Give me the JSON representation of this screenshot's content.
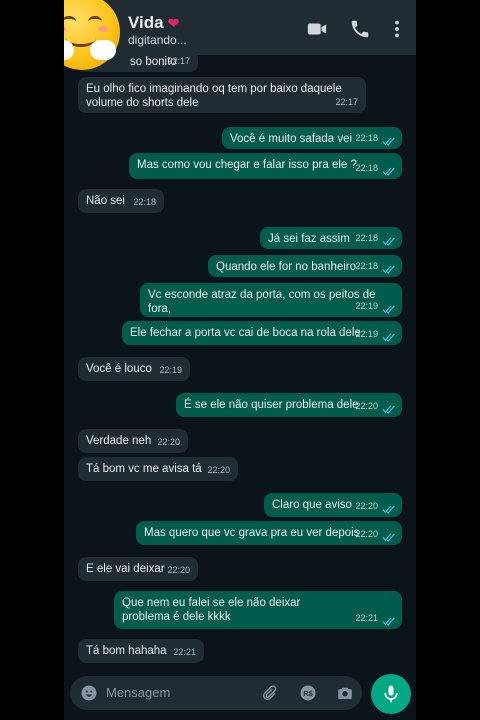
{
  "header": {
    "contact_name": "Vida",
    "heart_glyph": "❤",
    "status": "digitando...",
    "icons": [
      "video-call-icon",
      "phone-icon",
      "more-options-icon"
    ]
  },
  "messages": [
    {
      "dir": "in",
      "text": "so bonito",
      "time": "22:17"
    },
    {
      "dir": "in",
      "text": "Eu olho fico imaginando oq tem por baixo daquele volume do shorts dele",
      "time": "22:17"
    },
    {
      "dir": "out",
      "text": "Você é muito safada vei",
      "time": "22:18"
    },
    {
      "dir": "out",
      "text": "Mas como vou chegar e falar isso pra ele ?",
      "time": "22:18"
    },
    {
      "dir": "in",
      "text": "Não sei",
      "time": "22:18"
    },
    {
      "dir": "out",
      "text": "Já sei faz assim",
      "time": "22:18"
    },
    {
      "dir": "out",
      "text": "Quando ele for no banheiro",
      "time": "22:18"
    },
    {
      "dir": "out",
      "text": "Vc esconde atraz da porta, com os peitos de fora,",
      "time": "22:19"
    },
    {
      "dir": "out",
      "text": "Ele fechar a porta vc cai de boca na rola dele",
      "time": "22:19"
    },
    {
      "dir": "in",
      "text": "Você é louco",
      "time": "22:19"
    },
    {
      "dir": "out",
      "text": "É se ele não quiser problema dele",
      "time": "22:20"
    },
    {
      "dir": "in",
      "text": "Verdade neh",
      "time": "22:20"
    },
    {
      "dir": "in",
      "text": "Tá bom vc me avisa tá",
      "time": "22:20"
    },
    {
      "dir": "out",
      "text": "Claro que aviso",
      "time": "22:20"
    },
    {
      "dir": "out",
      "text": "Mas quero que vc grava pra eu ver depois",
      "time": "22:20"
    },
    {
      "dir": "in",
      "text": "E ele vai deixar",
      "time": "22:20"
    },
    {
      "dir": "out",
      "text": "Que nem eu falei se ele não deixar problema é dele kkkk",
      "time": "22:21"
    },
    {
      "dir": "in",
      "text": "Tá bom hahaha",
      "time": "22:21"
    }
  ],
  "input": {
    "placeholder": "Mensagem",
    "icons": [
      "emoji-icon",
      "attach-icon",
      "payment-icon",
      "camera-icon",
      "mic-icon"
    ]
  },
  "colors": {
    "background": "#0b141a",
    "header": "#1f2c34",
    "incoming": "#202c33",
    "outgoing": "#005c4b",
    "accent": "#00a884",
    "read_ticks": "#53bdeb"
  }
}
